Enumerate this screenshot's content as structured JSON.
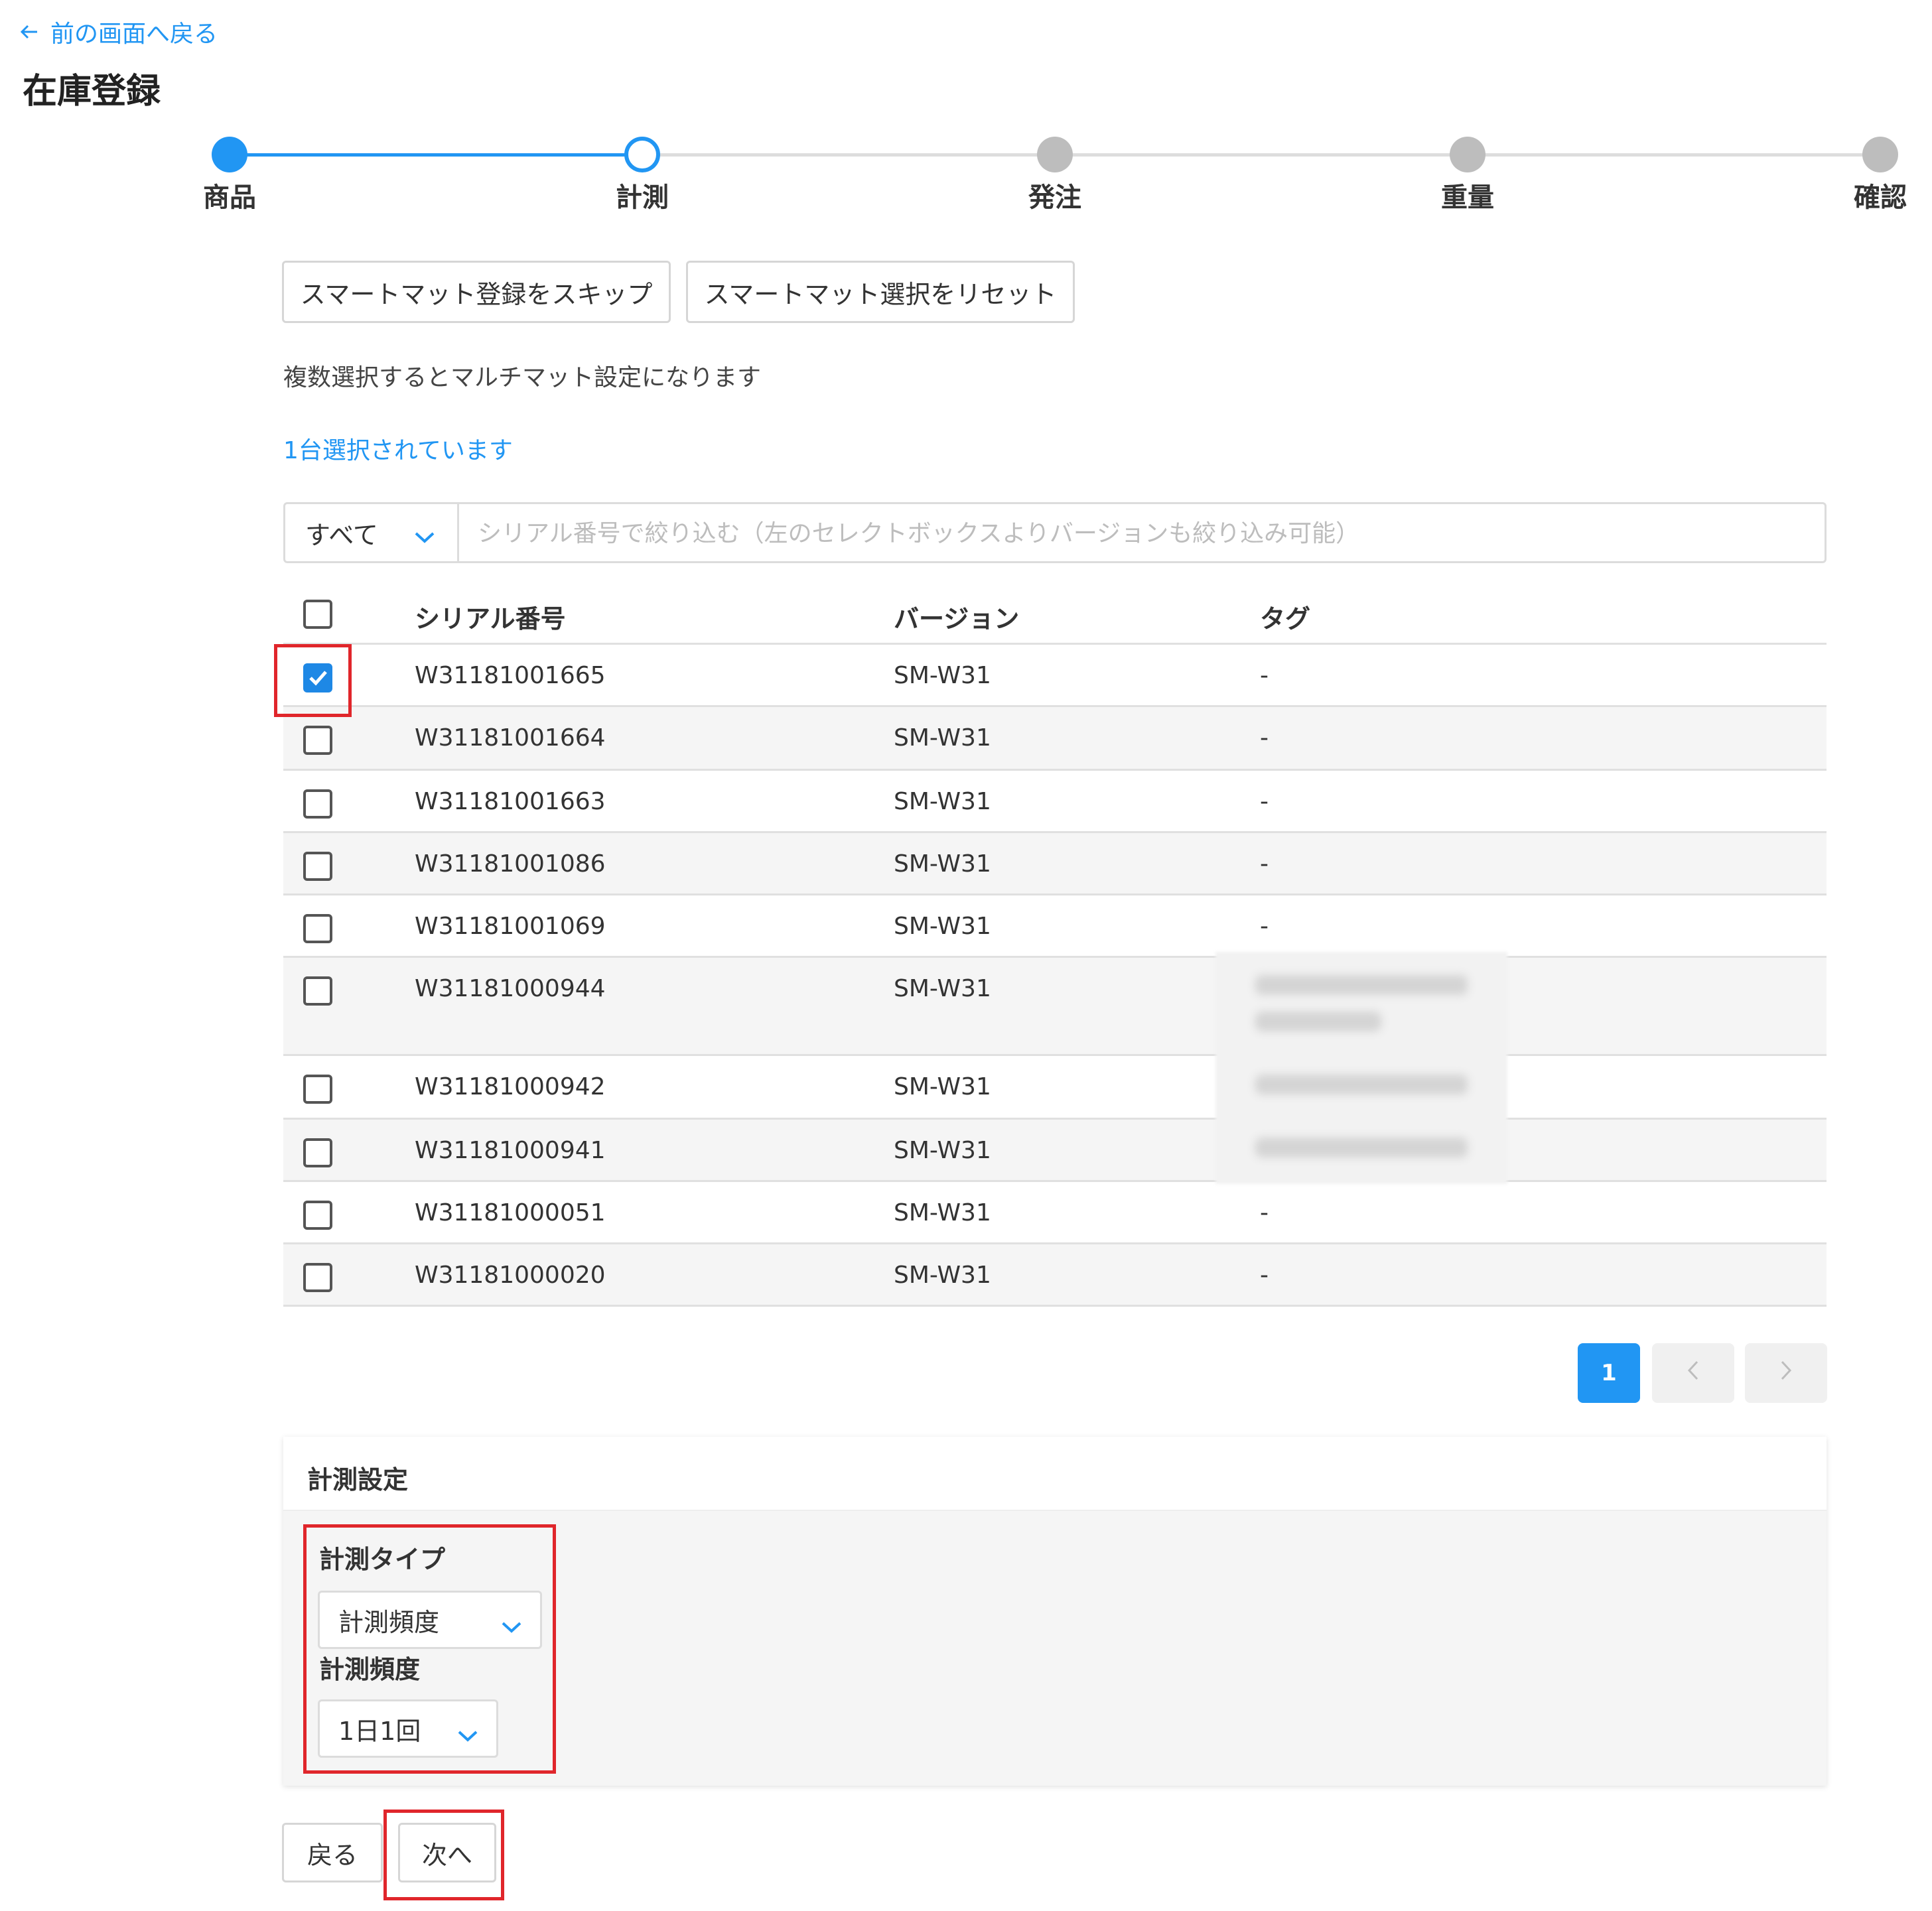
{
  "nav": {
    "back_label": "前の画面へ戻る"
  },
  "page": {
    "title": "在庫登録"
  },
  "steps": [
    {
      "label": "商品",
      "state": "done"
    },
    {
      "label": "計測",
      "state": "current"
    },
    {
      "label": "発注",
      "state": "todo"
    },
    {
      "label": "重量",
      "state": "todo"
    },
    {
      "label": "確認",
      "state": "todo"
    }
  ],
  "actions": {
    "skip_label": "スマートマット登録をスキップ",
    "reset_label": "スマートマット選択をリセット"
  },
  "note": "複数選択するとマルチマット設定になります",
  "selected_count_text": "1台選択されています",
  "filter": {
    "select_value": "すべて",
    "search_placeholder": "シリアル番号で絞り込む（左のセレクトボックスよりバージョンも絞り込み可能）"
  },
  "table": {
    "columns": [
      "シリアル番号",
      "バージョン",
      "タグ"
    ],
    "rows": [
      {
        "serial": "W31181001665",
        "version": "SM-W31",
        "tag": "-",
        "checked": true
      },
      {
        "serial": "W31181001664",
        "version": "SM-W31",
        "tag": "-",
        "checked": false
      },
      {
        "serial": "W31181001663",
        "version": "SM-W31",
        "tag": "-",
        "checked": false
      },
      {
        "serial": "W31181001086",
        "version": "SM-W31",
        "tag": "-",
        "checked": false
      },
      {
        "serial": "W31181001069",
        "version": "SM-W31",
        "tag": "-",
        "checked": false
      },
      {
        "serial": "W31181000944",
        "version": "SM-W31",
        "tag": "",
        "checked": false
      },
      {
        "serial": "W31181000942",
        "version": "SM-W31",
        "tag": "",
        "checked": false
      },
      {
        "serial": "W31181000941",
        "version": "SM-W31",
        "tag": "",
        "checked": false
      },
      {
        "serial": "W31181000051",
        "version": "SM-W31",
        "tag": "-",
        "checked": false
      },
      {
        "serial": "W31181000020",
        "version": "SM-W31",
        "tag": "-",
        "checked": false
      }
    ]
  },
  "pagination": {
    "current_page": "1"
  },
  "settings": {
    "title": "計測設定",
    "type_label": "計測タイプ",
    "type_value": "計測頻度",
    "freq_label": "計測頻度",
    "freq_value": "1日1回"
  },
  "footer": {
    "back_label": "戻る",
    "next_label": "次へ"
  },
  "colors": {
    "accent": "#2196f3",
    "highlight": "#e0262b",
    "inactive": "#bdbdbd"
  }
}
